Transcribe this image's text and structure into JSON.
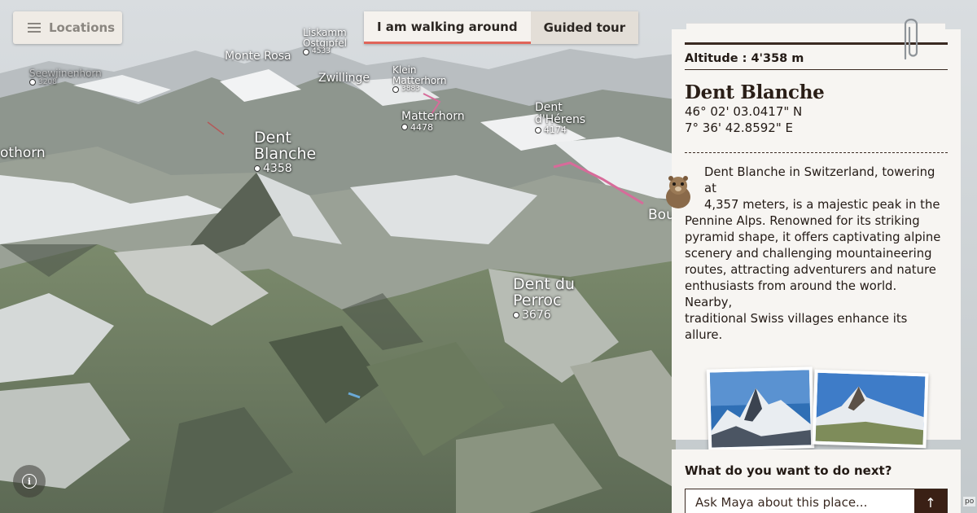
{
  "topbar": {
    "locations_label": "Locations",
    "mode_tabs": [
      {
        "label": "I am walking around",
        "active": true
      },
      {
        "label": "Guided tour",
        "active": false
      }
    ]
  },
  "map": {
    "peaks": [
      {
        "name": "Seewjinenhorn",
        "altitude": "3208"
      },
      {
        "name": "Monte Rosa",
        "altitude": ""
      },
      {
        "name": "Liskamm Ostgipfel",
        "name_lines": [
          "Liskamm",
          "Ostgipfel"
        ],
        "altitude": "4533"
      },
      {
        "name": "Zwillinge",
        "altitude": ""
      },
      {
        "name": "Klein Matterhorn",
        "name_lines": [
          "Klein",
          "Matterhorn"
        ],
        "altitude": "3883"
      },
      {
        "name": "Matterhorn",
        "altitude": "4478"
      },
      {
        "name": "Dent d'Hérens",
        "name_lines": [
          "Dent",
          "d'Hérens"
        ],
        "altitude": "4174"
      },
      {
        "name": "Dent Blanche",
        "name_lines": [
          "Dent",
          "Blanche"
        ],
        "altitude": "4358"
      },
      {
        "name": "Dent du Perroc",
        "name_lines": [
          "Dent du",
          "Perroc"
        ],
        "altitude": "3676"
      },
      {
        "name": "othorn",
        "altitude": ""
      },
      {
        "name": "Bou",
        "altitude": ""
      }
    ],
    "info_icon": "info-icon"
  },
  "panel": {
    "altitude_label": "Altitude : 4'358 m",
    "title": "Dent Blanche",
    "latitude": "46° 02' 03.0417\" N",
    "longitude": "7° 36' 42.8592\" E",
    "description": "Dent Blanche in Switzerland, towering at 4,357 meters, is a majestic peak in the Pennine Alps. Renowned for its striking pyramid shape, it offers captivating alpine scenery and challenging mountaineering routes, attracting adventurers and nature enthusiasts from around the world. Nearby, traditional Swiss villages enhance its allure.",
    "description_lines": [
      "Dent Blanche in Switzerland, towering at",
      "4,357 meters, is a majestic peak in the",
      "Pennine Alps. Renowned for its striking",
      "pyramid shape, it offers captivating alpine",
      "scenery and challenging mountaineering",
      "routes, attracting adventurers and nature",
      "enthusiasts from around the world. Nearby,",
      "traditional Swiss villages enhance its allure."
    ],
    "avatar": "marmot-avatar-icon",
    "clip_icon": "paperclip-icon"
  },
  "next": {
    "question": "What do you want to do next?",
    "input_placeholder": "Ask Maya about this place...",
    "send_icon": "arrow-up-icon",
    "send_glyph": "↑"
  },
  "corner_tag": "po",
  "colors": {
    "accent": "#e0655a",
    "panel_bg": "#f7f5f2",
    "ink": "#231a15",
    "send_bg": "#3a2015"
  }
}
